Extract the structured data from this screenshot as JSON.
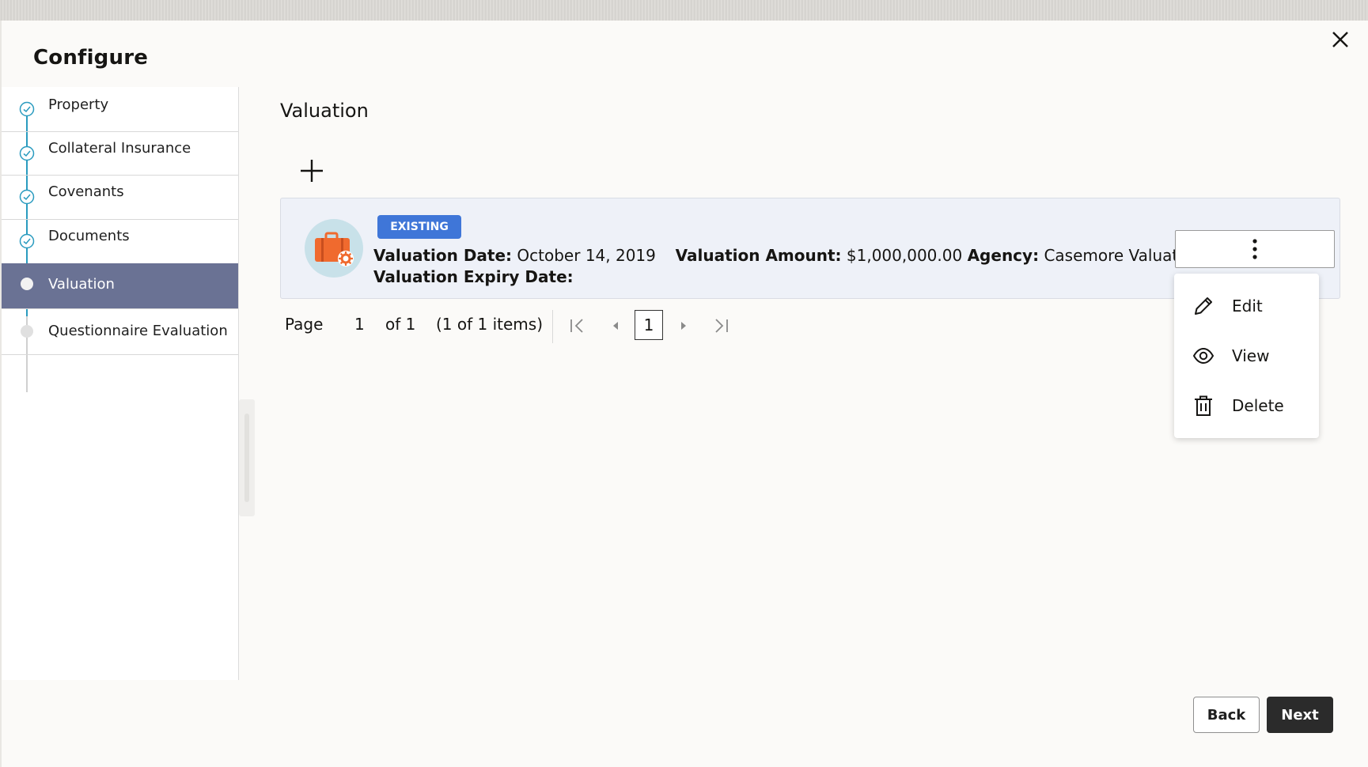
{
  "dialog": {
    "title": "Configure",
    "close_icon": "close-icon"
  },
  "sidebar": {
    "steps": [
      {
        "label": "Property",
        "status": "complete"
      },
      {
        "label": "Collateral Insurance",
        "status": "complete"
      },
      {
        "label": "Covenants",
        "status": "complete"
      },
      {
        "label": "Documents",
        "status": "complete"
      },
      {
        "label": "Valuation",
        "status": "active"
      },
      {
        "label": "Questionnaire Evaluation",
        "status": "pending"
      }
    ]
  },
  "main": {
    "section_title": "Valuation",
    "add_icon": "plus-icon",
    "card": {
      "badge": "EXISTING",
      "icon": "briefcase-gear-icon",
      "valuation_date_label": "Valuation Date:",
      "valuation_date": "October 14, 2019",
      "valuation_amount_label": "Valuation Amount:",
      "valuation_amount": "$1,000,000.00",
      "agency_label": "Agency:",
      "agency": "Casemore Valuations",
      "expiry_label": "Valuation Expiry Date:",
      "expiry": ""
    },
    "pagination": {
      "page_label": "Page",
      "page_value": "1",
      "of_label": "of 1",
      "items_label": "(1 of 1 items)",
      "current_page": "1"
    },
    "menu": {
      "items": [
        {
          "label": "Edit",
          "icon": "pencil-icon"
        },
        {
          "label": "View",
          "icon": "eye-icon"
        },
        {
          "label": "Delete",
          "icon": "trash-icon"
        }
      ]
    }
  },
  "footer": {
    "back_label": "Back",
    "next_label": "Next"
  },
  "colors": {
    "active_step": "#6a7294",
    "step_line": "#2a9bbf",
    "badge": "#3f76d8",
    "card_bg": "#eef1f8",
    "briefcase": "#f06a2e",
    "primary_button": "#2b2b2b"
  }
}
